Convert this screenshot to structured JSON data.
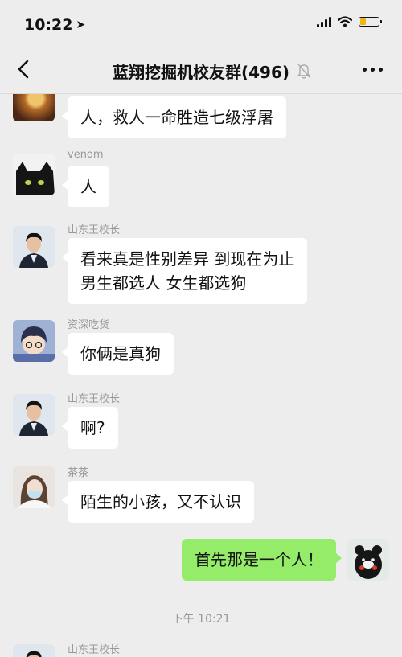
{
  "status": {
    "time": "10:22",
    "battery_level": 0.3,
    "battery_color": "#f1b70f"
  },
  "nav": {
    "title": "蓝翔挖掘机校友群(496)"
  },
  "messages": [
    {
      "sender": "",
      "text": "人，救人一命胜造七级浮屠"
    },
    {
      "sender": "venom",
      "text": "人"
    },
    {
      "sender": "山东王校长",
      "text_line1": "看来真是性别差异 到现在为止",
      "text_line2": "男生都选人 女生都选狗"
    },
    {
      "sender": "资深吃货",
      "text": "你俩是真狗"
    },
    {
      "sender": "山东王校长",
      "text": "啊?"
    },
    {
      "sender": "茶茶",
      "text": "陌生的小孩，又不认识"
    },
    {
      "sender": "",
      "text": "首先那是一个人！",
      "self": true
    },
    {
      "sender": "山东王校长",
      "text": ""
    }
  ],
  "timestamp": "下午 10:21",
  "colors": {
    "background": "#ededed",
    "self_bubble": "#95ec69",
    "other_bubble": "#ffffff"
  }
}
